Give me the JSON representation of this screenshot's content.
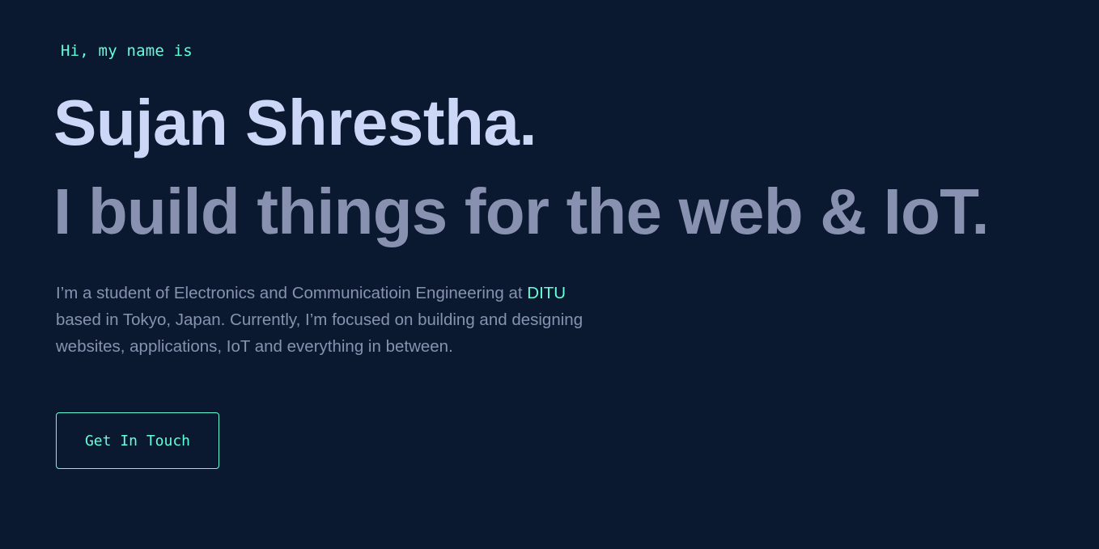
{
  "hero": {
    "intro": "Hi, my name is",
    "name": "Sujan Shrestha.",
    "tagline": "I build things for the web & IoT.",
    "bio": {
      "before": "I’m a student of Electronics and Communicatioin Engineering at ",
      "highlight": "DITU",
      "after": " based in Tokyo, Japan. Currently, I’m focused on building and designing websites, applications, IoT and everything in between."
    },
    "cta_label": "Get In Touch"
  },
  "colors": {
    "background": "#0a192f",
    "accent": "#64ffda",
    "heading": "#ccd6f6",
    "muted": "#8892b0"
  }
}
